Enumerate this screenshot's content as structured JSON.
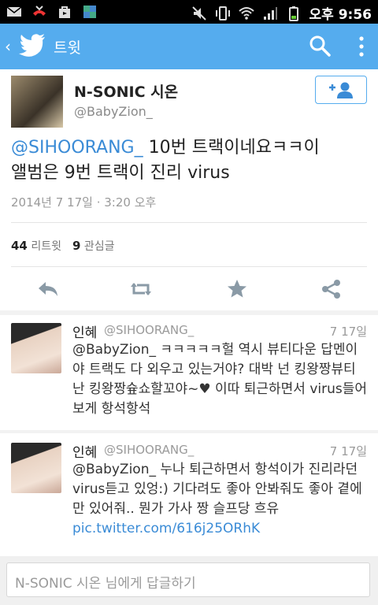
{
  "status_bar": {
    "time": "오후 9:56"
  },
  "app_bar": {
    "title": "트윗"
  },
  "tweet": {
    "author_name": "N-SONIC 시온",
    "author_handle": "@BabyZion_",
    "mention": "@SIHOORANG_",
    "text_line1_rest": " 10번 트랙이네요ㅋㅋ이",
    "text_line2": "앨범은 9번 트랙이 진리 virus",
    "timestamp": "2014년 7 17일 · 3:20 오후",
    "retweet_count": "44",
    "retweet_label": "리트윗",
    "favorite_count": "9",
    "favorite_label": "관심글"
  },
  "replies": [
    {
      "name": "인혜",
      "handle": "@SIHOORANG_",
      "date": "7 17일",
      "text": "@BabyZion_ ㅋㅋㅋㅋㅋ헐 역시 뷰티다운 답멘이야 트랙도 다 외우고 있는거야? 대박 넌 킹왕짱뷰티 난 킹왕짱슢쇼할꼬야~♥ 이따 퇴근하면서 virus들어보게 항석항석",
      "link": ""
    },
    {
      "name": "인혜",
      "handle": "@SIHOORANG_",
      "date": "7 17일",
      "text": "@BabyZion_ 누나 퇴근하면서 항석이가 진리라던 virus듣고 있엉:) 기다려도 좋아 안봐줘도 좋아 곁에만 있어줘.. 뭔가 가사 짱 슬프당 흐유 ",
      "link": "pic.twitter.com/616j25ORhK"
    }
  ],
  "composer": {
    "placeholder": "N-SONIC 시온 님에게 답글하기"
  },
  "colors": {
    "accent": "#55acee",
    "link": "#3a8bd6"
  }
}
